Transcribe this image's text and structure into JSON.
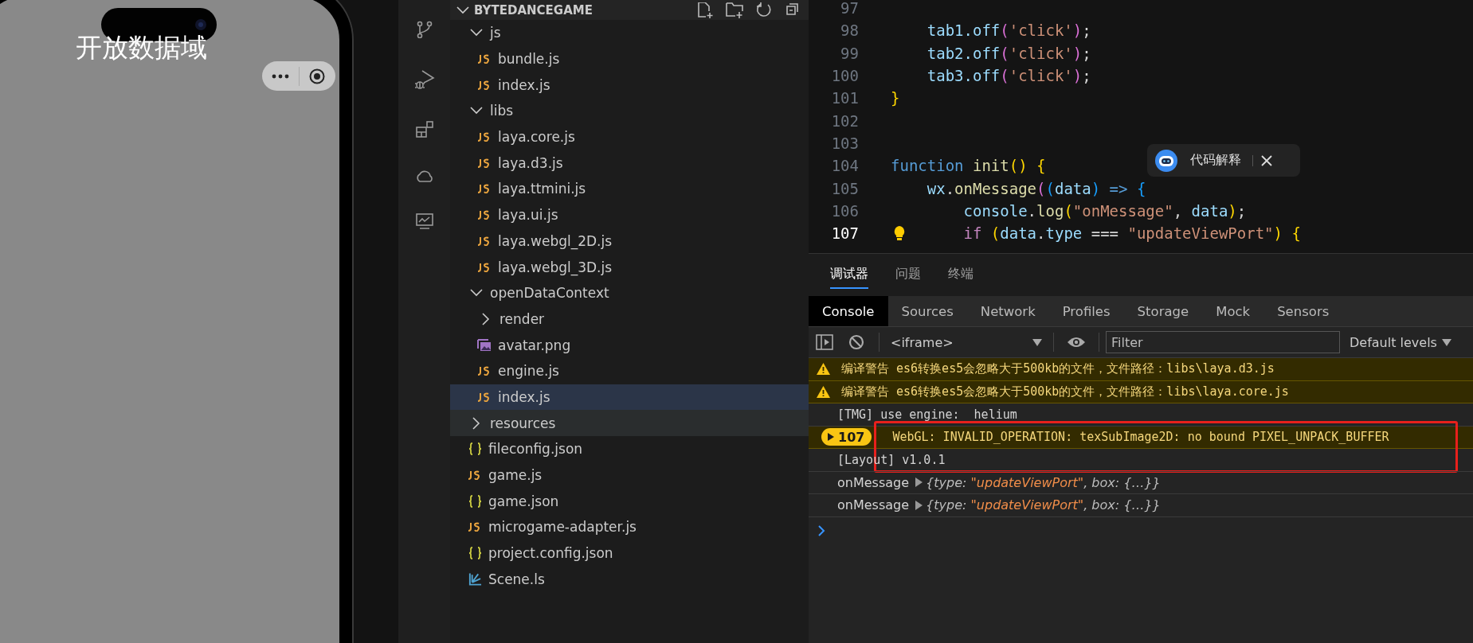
{
  "phone": {
    "title": "开放数据域"
  },
  "explorer": {
    "title": "BYTEDANCEGAME",
    "items": [
      {
        "label": "js",
        "kind": "folder",
        "expanded": true,
        "selected": false,
        "hovered": false,
        "children": [
          {
            "label": "bundle.js",
            "kind": "js",
            "selected": false,
            "hovered": false
          },
          {
            "label": "index.js",
            "kind": "js",
            "selected": false,
            "hovered": false
          }
        ]
      },
      {
        "label": "libs",
        "kind": "folder",
        "expanded": true,
        "selected": false,
        "hovered": false,
        "children": [
          {
            "label": "laya.core.js",
            "kind": "js",
            "selected": false,
            "hovered": false
          },
          {
            "label": "laya.d3.js",
            "kind": "js",
            "selected": false,
            "hovered": false
          },
          {
            "label": "laya.ttmini.js",
            "kind": "js",
            "selected": false,
            "hovered": false
          },
          {
            "label": "laya.ui.js",
            "kind": "js",
            "selected": false,
            "hovered": false
          },
          {
            "label": "laya.webgl_2D.js",
            "kind": "js",
            "selected": false,
            "hovered": false
          },
          {
            "label": "laya.webgl_3D.js",
            "kind": "js",
            "selected": false,
            "hovered": false
          }
        ]
      },
      {
        "label": "openDataContext",
        "kind": "folder",
        "expanded": true,
        "selected": false,
        "hovered": false,
        "children": [
          {
            "label": "render",
            "kind": "folder",
            "expanded": false,
            "selected": false,
            "hovered": false
          },
          {
            "label": "avatar.png",
            "kind": "image",
            "selected": false,
            "hovered": false
          },
          {
            "label": "engine.js",
            "kind": "js",
            "selected": false,
            "hovered": false
          },
          {
            "label": "index.js",
            "kind": "js",
            "selected": true,
            "hovered": false
          }
        ]
      },
      {
        "label": "resources",
        "kind": "folder",
        "expanded": false,
        "selected": false,
        "hovered": true
      },
      {
        "label": "fileconfig.json",
        "kind": "json",
        "selected": false,
        "hovered": false
      },
      {
        "label": "game.js",
        "kind": "js",
        "selected": false,
        "hovered": false
      },
      {
        "label": "game.json",
        "kind": "json",
        "selected": false,
        "hovered": false
      },
      {
        "label": "microgame-adapter.js",
        "kind": "js",
        "selected": false,
        "hovered": false
      },
      {
        "label": "project.config.json",
        "kind": "json",
        "selected": false,
        "hovered": false
      },
      {
        "label": "Scene.ls",
        "kind": "scene",
        "selected": false,
        "hovered": false
      }
    ]
  },
  "editor": {
    "lines": [
      {
        "number": "97",
        "current": false,
        "lightbulb": false
      },
      {
        "number": "98",
        "current": false,
        "lightbulb": false,
        "tokens": [
          {
            "text": "    tab1",
            "kind": "var"
          },
          {
            "text": ".off",
            "kind": "var"
          },
          {
            "text": "(",
            "kind": "bracket2"
          },
          {
            "text": "'click'",
            "kind": "string"
          },
          {
            "text": ")",
            "kind": "bracket2"
          },
          {
            "text": ";",
            "kind": "plain"
          }
        ]
      },
      {
        "number": "99",
        "current": false,
        "lightbulb": false,
        "tokens": [
          {
            "text": "    tab2",
            "kind": "var"
          },
          {
            "text": ".off",
            "kind": "var"
          },
          {
            "text": "(",
            "kind": "bracket2"
          },
          {
            "text": "'click'",
            "kind": "string"
          },
          {
            "text": ")",
            "kind": "bracket2"
          },
          {
            "text": ";",
            "kind": "plain"
          }
        ]
      },
      {
        "number": "100",
        "current": false,
        "lightbulb": false,
        "tokens": [
          {
            "text": "    tab3",
            "kind": "var"
          },
          {
            "text": ".off",
            "kind": "var"
          },
          {
            "text": "(",
            "kind": "bracket2"
          },
          {
            "text": "'click'",
            "kind": "string"
          },
          {
            "text": ")",
            "kind": "bracket2"
          },
          {
            "text": ";",
            "kind": "plain"
          }
        ]
      },
      {
        "number": "101",
        "current": false,
        "lightbulb": false,
        "tokens": [
          {
            "text": "}",
            "kind": "bracket1"
          }
        ]
      },
      {
        "number": "102",
        "current": false,
        "lightbulb": false
      },
      {
        "number": "103",
        "current": false,
        "lightbulb": false
      },
      {
        "number": "104",
        "current": false,
        "lightbulb": false,
        "tokens": [
          {
            "text": "function",
            "kind": "keyword"
          },
          {
            "text": " init",
            "kind": "func"
          },
          {
            "text": "()",
            "kind": "bracket1"
          },
          {
            "text": " {",
            "kind": "bracket1"
          }
        ]
      },
      {
        "number": "105",
        "current": false,
        "lightbulb": false,
        "tokens": [
          {
            "text": "    wx",
            "kind": "var"
          },
          {
            "text": ".",
            "kind": "plain"
          },
          {
            "text": "onMessage",
            "kind": "func"
          },
          {
            "text": "(",
            "kind": "bracket2"
          },
          {
            "text": "(",
            "kind": "bracket3"
          },
          {
            "text": "data",
            "kind": "var"
          },
          {
            "text": ")",
            "kind": "bracket3"
          },
          {
            "text": " =>",
            "kind": "keyword"
          },
          {
            "text": " {",
            "kind": "bracket3"
          }
        ]
      },
      {
        "number": "106",
        "current": false,
        "lightbulb": false,
        "tokens": [
          {
            "text": "        console",
            "kind": "var"
          },
          {
            "text": ".",
            "kind": "plain"
          },
          {
            "text": "log",
            "kind": "func"
          },
          {
            "text": "(",
            "kind": "bracket1"
          },
          {
            "text": "\"onMessage\"",
            "kind": "string"
          },
          {
            "text": ",",
            "kind": "plain"
          },
          {
            "text": " data",
            "kind": "var"
          },
          {
            "text": ")",
            "kind": "bracket1"
          },
          {
            "text": ";",
            "kind": "plain"
          }
        ]
      },
      {
        "number": "107",
        "current": true,
        "lightbulb": true,
        "tokens": [
          {
            "text": "        if",
            "kind": "control"
          },
          {
            "text": " (",
            "kind": "bracket1"
          },
          {
            "text": "data",
            "kind": "var"
          },
          {
            "text": ".",
            "kind": "plain"
          },
          {
            "text": "type",
            "kind": "var"
          },
          {
            "text": " ===",
            "kind": "plain"
          },
          {
            "text": " \"updateViewPort\"",
            "kind": "string"
          },
          {
            "text": ")",
            "kind": "bracket1"
          },
          {
            "text": " {",
            "kind": "bracket1"
          }
        ]
      }
    ],
    "popup": {
      "label": "代码解释"
    }
  },
  "panel": {
    "tabs": [
      {
        "label": "调试器",
        "selected": true
      },
      {
        "label": "问题",
        "selected": false
      },
      {
        "label": "终端",
        "selected": false
      }
    ],
    "devtools_tabs": [
      {
        "label": "Console",
        "selected": true
      },
      {
        "label": "Sources",
        "selected": false
      },
      {
        "label": "Network",
        "selected": false
      },
      {
        "label": "Profiles",
        "selected": false
      },
      {
        "label": "Storage",
        "selected": false
      },
      {
        "label": "Mock",
        "selected": false
      },
      {
        "label": "Sensors",
        "selected": false
      }
    ],
    "toolbar": {
      "context": "<iframe>",
      "filter_placeholder": "Filter",
      "levels": "Default levels"
    },
    "messages": [
      {
        "kind": "warning",
        "text": "编译警告 es6转换es5会忽略大于500kb的文件，文件路径：libs\\laya.d3.js"
      },
      {
        "kind": "warning",
        "text": "编译警告 es6转换es5会忽略大于500kb的文件，文件路径：libs\\laya.core.js"
      },
      {
        "kind": "log",
        "text": "[TMG] use engine:  helium"
      },
      {
        "kind": "repeat",
        "count": "107",
        "text": "WebGL: INVALID_OPERATION: texSubImage2D: no bound PIXEL_UNPACK_BUFFER"
      },
      {
        "kind": "log",
        "text": "[Layout] v1.0.1"
      },
      {
        "kind": "object",
        "text": "onMessage",
        "preview": [
          {
            "text": "{type: ",
            "kind": "plain"
          },
          {
            "text": "\"updateViewPort\"",
            "kind": "string"
          },
          {
            "text": ", box: {…}}",
            "kind": "plain"
          }
        ]
      },
      {
        "kind": "object",
        "text": "onMessage",
        "preview": [
          {
            "text": "{type: ",
            "kind": "plain"
          },
          {
            "text": "\"updateViewPort\"",
            "kind": "string"
          },
          {
            "text": ", box: {…}}",
            "kind": "plain"
          }
        ]
      },
      {
        "kind": "prompt"
      }
    ]
  }
}
